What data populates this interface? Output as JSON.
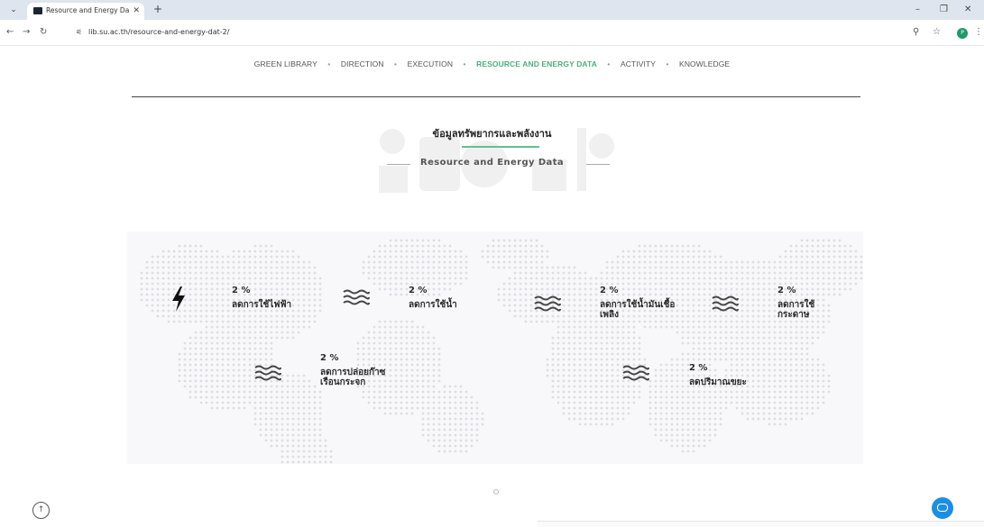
{
  "browser": {
    "tab_title": "Resource and Energy Data – Th",
    "url": "lib.su.ac.th/resource-and-energy-dat-2/",
    "profile_initial": "P"
  },
  "nav": {
    "items": [
      "GREEN LIBRARY",
      "DIRECTION",
      "EXECUTION",
      "RESOURCE AND ENERGY DATA",
      "ACTIVITY",
      "KNOWLEDGE"
    ],
    "active_index": 3,
    "separator": "•"
  },
  "heading": {
    "title_th": "ข้อมูลทรัพยากรและพลังงาน",
    "title_en": "Resource and Energy Data"
  },
  "stats": [
    {
      "icon": "lightning-icon",
      "percent": "2 %",
      "label": "ลดการใช้ไฟฟ้า"
    },
    {
      "icon": "waves-icon",
      "percent": "2 %",
      "label": "ลดการใช้น้ำ"
    },
    {
      "icon": "waves-icon",
      "percent": "2 %",
      "label": "ลดการใช้น้ำมันเชื้อเพลิง"
    },
    {
      "icon": "waves-icon",
      "percent": "2 %",
      "label": "ลดการใช้กระดาษ"
    },
    {
      "icon": "waves-icon",
      "percent": "2 %",
      "label": "ลดการปล่อยก๊าซเรือนกระจก"
    },
    {
      "icon": "waves-icon",
      "percent": "2 %",
      "label": "ลดปริมาณขยะ"
    }
  ],
  "colors": {
    "accent": "#4caf79",
    "map_dot": "#dcdde4",
    "chat": "#1d8fe0"
  }
}
